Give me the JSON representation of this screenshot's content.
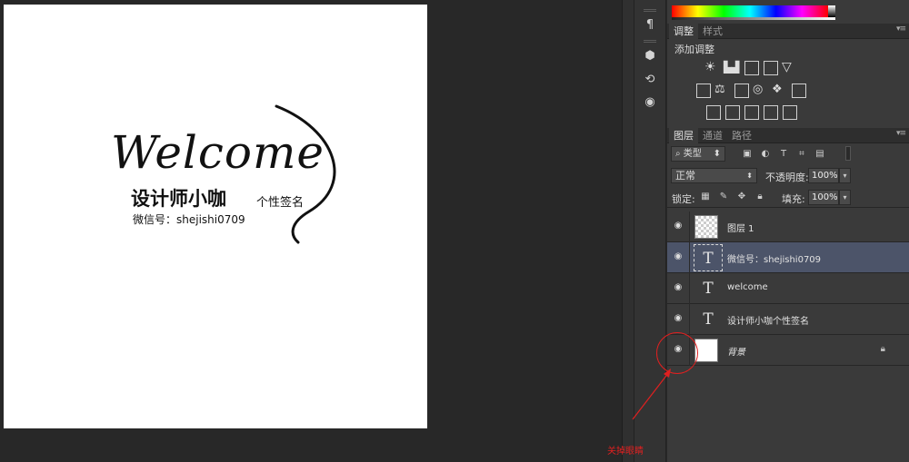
{
  "canvas": {
    "welcome": "Welcome",
    "title_cn": "设计师小咖",
    "title_cn_small": "个性签名",
    "wechat": "微信号：shejishi0709"
  },
  "panel_adjust": {
    "tabs": [
      "调整",
      "样式"
    ],
    "add_adjustment_label": "添加调整",
    "menu_icon": "panel-menu-icon"
  },
  "panel_layers": {
    "tabs": [
      "图层",
      "通道",
      "路径"
    ],
    "kind_select": "类型",
    "blend_mode": "正常",
    "opacity_label": "不透明度:",
    "opacity_value": "100%",
    "lock_label": "锁定:",
    "fill_label": "填充:",
    "fill_value": "100%",
    "layers": [
      {
        "name": "图层 1",
        "kind": "pixel",
        "visible": true,
        "selected": false
      },
      {
        "name": "微信号：shejishi0709",
        "kind": "type",
        "visible": true,
        "selected": true
      },
      {
        "name": "welcome",
        "kind": "type",
        "visible": true,
        "selected": false
      },
      {
        "name": "设计师小咖个性签名",
        "kind": "type",
        "visible": true,
        "selected": false
      },
      {
        "name": "背景",
        "kind": "background",
        "visible": true,
        "selected": false,
        "locked": true
      }
    ]
  },
  "annotation": {
    "text": "关掉眼睛",
    "color": "#e02020"
  },
  "colors": {
    "workspace": "#282828",
    "panel": "#3a3a3a",
    "selected_layer": "#4c5469"
  }
}
